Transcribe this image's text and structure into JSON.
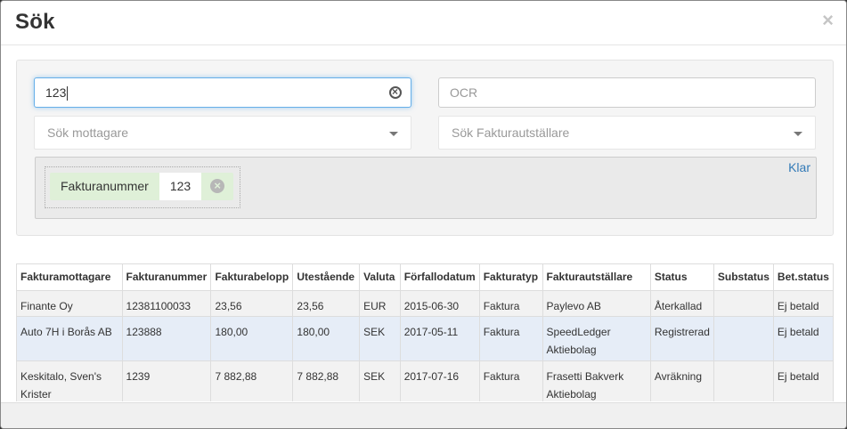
{
  "modal": {
    "title": "Sök",
    "close_label": "×"
  },
  "search": {
    "invoice_number_value": "123",
    "ocr_placeholder": "OCR",
    "recipient_placeholder": "Sök mottagare",
    "issuer_placeholder": "Sök Fakturautställare",
    "done_label": "Klar"
  },
  "filter_chip": {
    "label": "Fakturanummer",
    "value": "123",
    "remove_icon": "×"
  },
  "table": {
    "columns": [
      "Fakturamottagare",
      "Fakturanummer",
      "Fakturabelopp",
      "Utestående",
      "Valuta",
      "Förfallodatum",
      "Fakturatyp",
      "Fakturautställare",
      "Status",
      "Substatus",
      "Bet.status"
    ],
    "rows": [
      [
        "Finante Oy",
        "12381100033",
        "23,56",
        "23,56",
        "EUR",
        "2015-06-30",
        "Faktura",
        "Paylevo AB",
        "Återkallad",
        "",
        "Ej betald"
      ],
      [
        "Auto 7H i Borås AB",
        "123888",
        "180,00",
        "180,00",
        "SEK",
        "2017-05-11",
        "Faktura",
        "SpeedLedger Aktiebolag",
        "Registrerad",
        "",
        "Ej betald"
      ],
      [
        "Keskitalo, Sven's Krister",
        "1239",
        "7 882,88",
        "7 882,88",
        "SEK",
        "2017-07-16",
        "Faktura",
        "Frasetti Bakverk Aktiebolag",
        "Avräkning",
        "",
        "Ej betald"
      ]
    ]
  },
  "colors": {
    "focus": "#66afe9",
    "chip_bg": "#dff0d8",
    "link": "#337ab7",
    "selected_row": "#e6edf7"
  },
  "icons": {
    "close": "close-icon",
    "clear": "clear-input-icon",
    "dropdown": "chevron-down-icon",
    "remove": "remove-filter-icon"
  }
}
